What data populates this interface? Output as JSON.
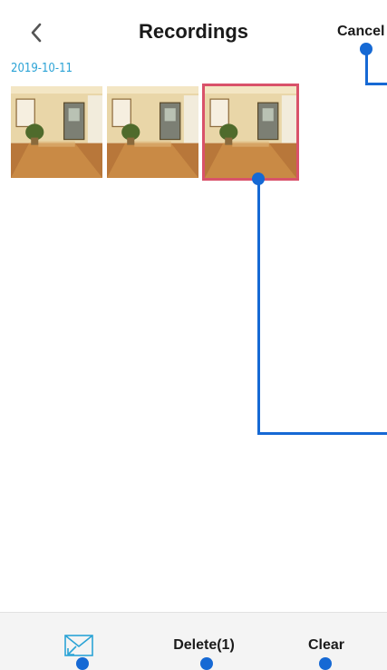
{
  "header": {
    "title": "Recordings",
    "cancel_label": "Cancel",
    "back_icon": "chevron-left-icon"
  },
  "recordings": {
    "date": "2019-10-11",
    "items": [
      {
        "selected": false
      },
      {
        "selected": false
      },
      {
        "selected": true
      }
    ]
  },
  "toolbar": {
    "mail_icon": "mail-icon",
    "delete_label": "Delete(1)",
    "clear_label": "Clear"
  },
  "colors": {
    "accent": "#2ba3d6",
    "selection_border": "#d9526a",
    "annotation": "#1669d4",
    "bottom_bar": "#f4f4f4"
  }
}
